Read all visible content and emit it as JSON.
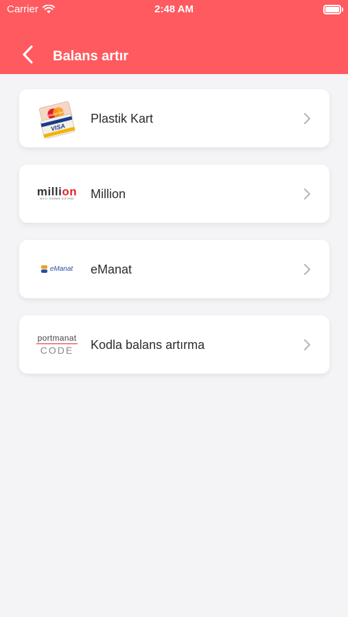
{
  "status_bar": {
    "carrier": "Carrier",
    "time": "2:48 AM"
  },
  "nav": {
    "title": "Balans artır"
  },
  "colors": {
    "header": "#fe5a5f",
    "background": "#f4f4f6"
  },
  "payment_methods": [
    {
      "label": "Plastik Kart",
      "icon": "card-logos-icon"
    },
    {
      "label": "Million",
      "icon": "million-logo"
    },
    {
      "label": "eManat",
      "icon": "emanat-logo"
    },
    {
      "label": "Kodla balans artırma",
      "icon": "portmanat-code-logo"
    }
  ],
  "logos": {
    "million_word": "milli",
    "million_on": "on",
    "million_tag": "MİLLİ ÖDƏMƏ SİSTEMİ",
    "emanat_text": "eManat",
    "portmanat_text": "portmanat",
    "portmanat_code": "CODE",
    "mastercard_text": "MasterCard",
    "visa_text": "VISA"
  }
}
